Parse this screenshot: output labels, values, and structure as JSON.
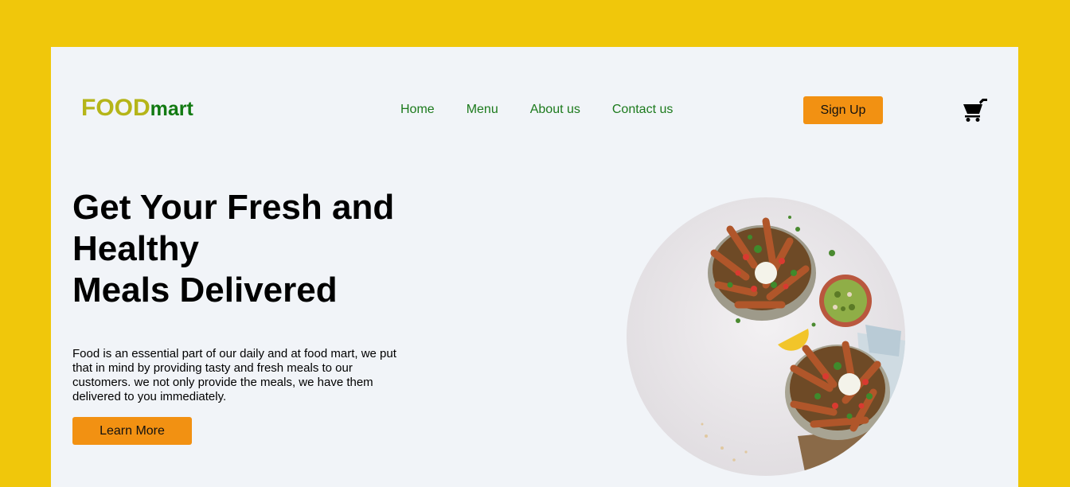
{
  "brand": {
    "part1": "FOOD",
    "part2": "mart"
  },
  "nav": {
    "items": [
      {
        "label": "Home"
      },
      {
        "label": "Menu"
      },
      {
        "label": "About us"
      },
      {
        "label": "Contact us"
      }
    ]
  },
  "header": {
    "signup_label": "Sign Up",
    "cart_icon": "shopping-cart-icon"
  },
  "hero": {
    "title_line1": "Get Your Fresh and",
    "title_line2": "Healthy",
    "title_line3": "Meals Delivered",
    "description": "Food is an essential part of our daily and at food mart, we put that in mind by providing tasty and fresh meals to our customers. we not only provide the meals, we have them delivered to you immediately.",
    "cta_label": "Learn More",
    "image_icon": "food-bowls-photo"
  },
  "colors": {
    "background": "#f0c70b",
    "card": "#f1f4f8",
    "accent": "#f29112",
    "nav_text": "#1c7a1c",
    "logo_food": "#b5b519",
    "logo_mart": "#127a12"
  }
}
